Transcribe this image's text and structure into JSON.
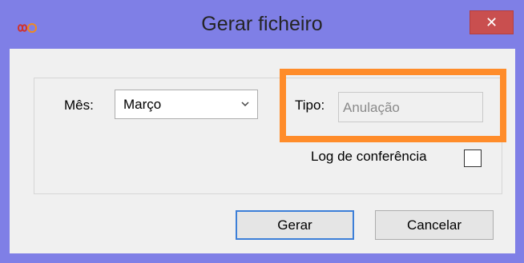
{
  "window": {
    "title": "Gerar ficheiro",
    "close_glyph": "✕",
    "app_icon": "infinity-icon",
    "titlebar_color": "#7f7fe6",
    "highlight_color": "#ff8c2a"
  },
  "form": {
    "mes_label": "Mês:",
    "mes_value": "Março",
    "tipo_label": "Tipo:",
    "tipo_value": "Anulação",
    "log_label": "Log de conferência",
    "log_checked": false
  },
  "buttons": {
    "gerar_label": "Gerar",
    "cancelar_label": "Cancelar"
  }
}
